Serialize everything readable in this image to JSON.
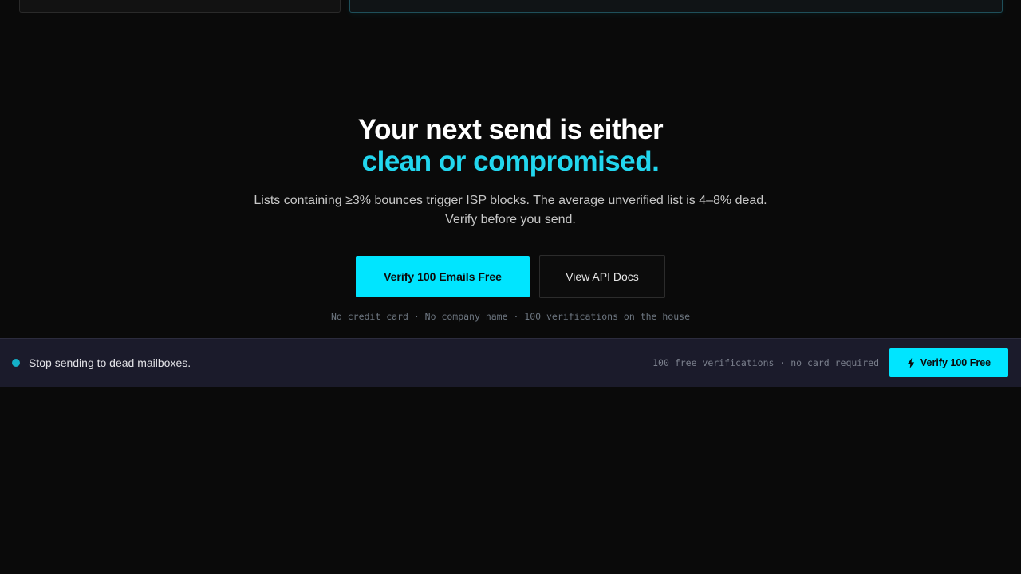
{
  "cta": {
    "headline_line1": "Your next send is either",
    "headline_line2": "clean or compromised.",
    "subtext_line1": "Lists containing ≥3% bounces trigger ISP blocks. The average unverified list is 4–8% dead.",
    "subtext_line2": "Verify before you send.",
    "primary_button": "Verify 100 Emails Free",
    "secondary_button": "View API Docs",
    "fineprint": "No credit card · No company name · 100 verifications on the house"
  },
  "sticky_bar": {
    "message": "Stop sending to dead mailboxes.",
    "note": "100 free verifications · no card required",
    "button_label": "Verify 100 Free",
    "button_icon": "lightning-bolt-icon"
  },
  "colors": {
    "background": "#0a0a0a",
    "accent": "#00e5ff",
    "headline_accent": "#22d6ee",
    "bar_background": "#1b1b2b",
    "status_dot": "#14b0c7"
  }
}
